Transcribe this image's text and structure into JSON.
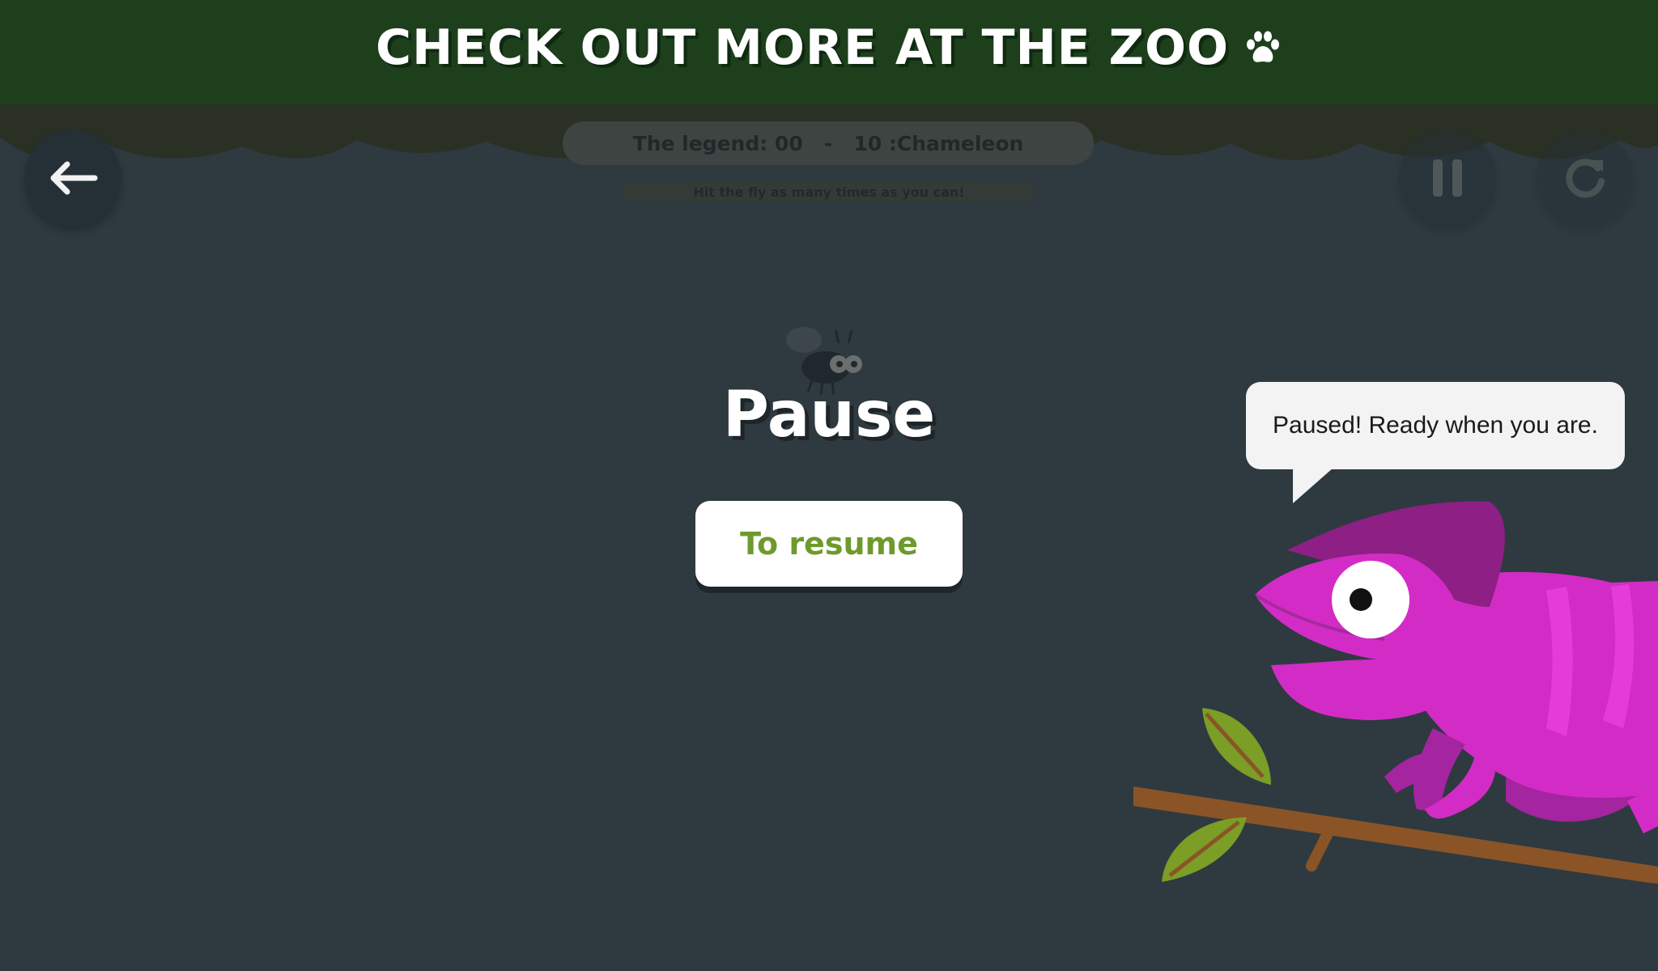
{
  "banner": {
    "text": "CHECK OUT MORE AT THE ZOO",
    "icon": "paw-icon"
  },
  "header": {
    "back_icon": "arrow-left-icon",
    "pause_icon": "pause-icon",
    "reload_icon": "reload-icon",
    "legend_text": "The legend: 00   -   10 :Chameleon",
    "hint_text": "Hit the fly as many times as you can!"
  },
  "pause_overlay": {
    "title": "Pause",
    "resume_label": "To resume"
  },
  "speech_bubble": {
    "text": "Paused! Ready when you are."
  },
  "colors": {
    "background": "#2e3a40",
    "banner": "#1e3f1c",
    "resume_text": "#6e9a2c",
    "chameleon": "#d32cc6",
    "branch": "#8a5427",
    "leaf": "#7a9e26"
  }
}
